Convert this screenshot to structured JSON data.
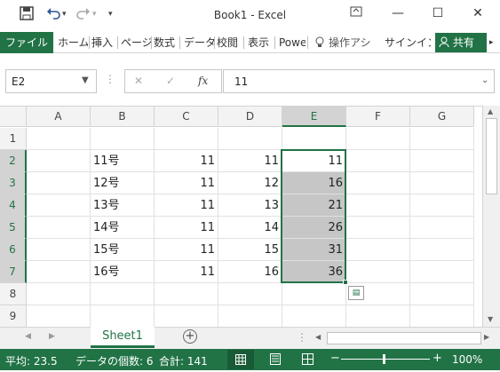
{
  "app": {
    "title": "Book1 - Excel"
  },
  "qat": {
    "save_icon": "save-icon",
    "undo_icon": "undo-icon",
    "redo_icon": "redo-icon",
    "customize_icon": "customize-icon"
  },
  "window": {
    "ribbon_display": "ribbon-display-icon",
    "minimize": "minimize-icon",
    "maximize": "maximize-icon",
    "close": "close-icon"
  },
  "ribbon": {
    "file": "ファイル",
    "tabs": [
      "ホーム",
      "挿入",
      "ページ",
      "数式",
      "データ",
      "校閲",
      "表示",
      "Powe"
    ],
    "tellme": "操作アシ",
    "signin": "サインイン",
    "share": "共有"
  },
  "formula_bar": {
    "name_box": "E2",
    "cancel": "✕",
    "enter": "✓",
    "fx": "fx",
    "value": "11"
  },
  "grid": {
    "columns": [
      "A",
      "B",
      "C",
      "D",
      "E",
      "F",
      "G"
    ],
    "selected_column": "E",
    "rows": [
      {
        "n": "1",
        "A": "",
        "B": "",
        "C": "",
        "D": "",
        "E": ""
      },
      {
        "n": "2",
        "A": "",
        "B": "11号",
        "C": "11",
        "D": "11",
        "E": "11"
      },
      {
        "n": "3",
        "A": "",
        "B": "12号",
        "C": "11",
        "D": "12",
        "E": "16"
      },
      {
        "n": "4",
        "A": "",
        "B": "13号",
        "C": "11",
        "D": "13",
        "E": "21"
      },
      {
        "n": "5",
        "A": "",
        "B": "14号",
        "C": "11",
        "D": "14",
        "E": "26"
      },
      {
        "n": "6",
        "A": "",
        "B": "15号",
        "C": "11",
        "D": "15",
        "E": "31"
      },
      {
        "n": "7",
        "A": "",
        "B": "16号",
        "C": "11",
        "D": "16",
        "E": "36"
      },
      {
        "n": "8",
        "A": "",
        "B": "",
        "C": "",
        "D": "",
        "E": ""
      },
      {
        "n": "9",
        "A": "",
        "B": "",
        "C": "",
        "D": "",
        "E": ""
      }
    ]
  },
  "sheets": {
    "active": "Sheet1",
    "add_icon": "add-sheet-icon"
  },
  "status": {
    "average": "平均: 23.5",
    "count": "データの個数: 6",
    "sum": "合計: 141",
    "zoom": "100%"
  }
}
